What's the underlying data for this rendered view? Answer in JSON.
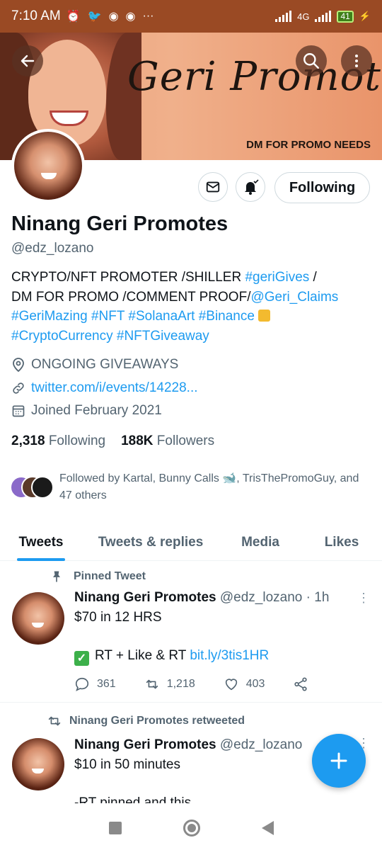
{
  "status_bar": {
    "time": "7:10 AM",
    "battery": "41",
    "network": "4G"
  },
  "banner": {
    "script_text": "Geri Promotes",
    "tagline": "DM FOR PROMO NEEDS"
  },
  "profile": {
    "following_button": "Following",
    "name": "Ninang Geri Promotes",
    "handle": "@edz_lozano",
    "bio": {
      "line1_text": "CRYPTO/NFT PROMOTER /SHILLER ",
      "line1_tag": "#geriGives",
      "line1_end": " /",
      "line2_text": "DM FOR PROMO /COMMENT PROOF/",
      "line2_mention": "@Geri_Claims",
      "line3_tags": "#GeriMazing #NFT #SolanaArt #Binance",
      "line4_tags": "#CryptoCurrency #NFTGiveaway"
    },
    "location": "ONGOING GIVEAWAYS",
    "website": "twitter.com/i/events/14228...",
    "joined": "Joined February 2021",
    "following_count": "2,318",
    "following_label": "Following",
    "followers_count": "188K",
    "followers_label": "Followers",
    "followed_by": "Followed by Kartal, Bunny Calls 🐋, TrisThePromoGuy, and 47 others"
  },
  "tabs": [
    {
      "label": "Tweets",
      "active": true
    },
    {
      "label": "Tweets & replies"
    },
    {
      "label": "Media"
    },
    {
      "label": "Likes"
    }
  ],
  "tweets": [
    {
      "context": "Pinned Tweet",
      "author": "Ninang Geri Promotes",
      "meta": "@edz_lozano · 1h",
      "line1": "$70 in 12 HRS",
      "line2_text": "RT  + Like & RT ",
      "line2_link": "bit.ly/3tis1HR",
      "replies": "361",
      "retweets": "1,218",
      "likes": "403"
    },
    {
      "context": "Ninang Geri Promotes retweeted",
      "author": "Ninang Geri Promotes",
      "meta": "@edz_lozano",
      "line1": "$10 in 50 minutes",
      "line2_text": "-RT pinned and this"
    }
  ],
  "icons": [
    "back-arrow-icon",
    "search-icon",
    "more-icon",
    "mail-icon",
    "bell-icon",
    "location-icon",
    "link-icon",
    "calendar-icon",
    "pin-icon",
    "retweet-icon",
    "reply-icon",
    "like-icon",
    "share-icon",
    "compose-icon"
  ],
  "colors": {
    "accent": "#1d9bf0",
    "status_bar": "#9a4a24",
    "banner": "#f0b08b"
  }
}
